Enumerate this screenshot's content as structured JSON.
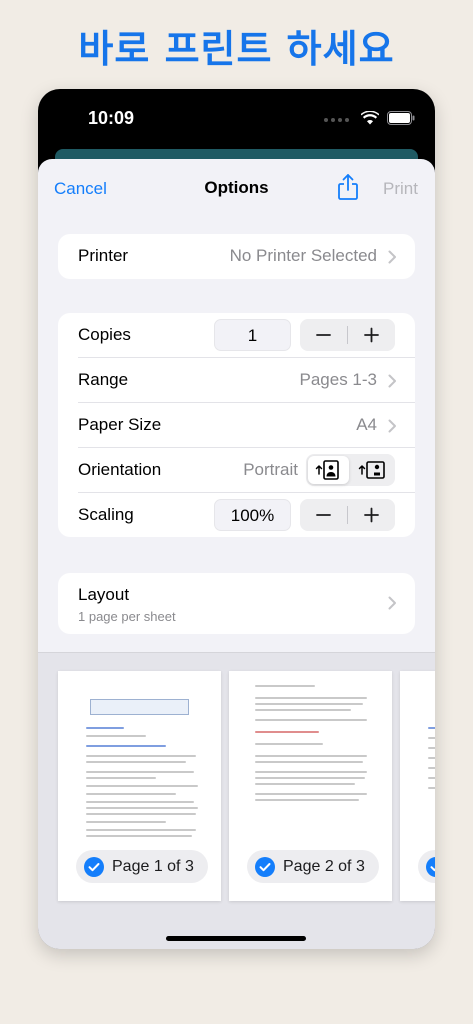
{
  "promo": {
    "headline": "바로 프린트 하세요"
  },
  "status_bar": {
    "time": "10:09"
  },
  "nav": {
    "cancel": "Cancel",
    "title": "Options",
    "print": "Print",
    "share_icon": "share-icon"
  },
  "printer": {
    "label": "Printer",
    "value": "No Printer Selected"
  },
  "options": {
    "copies": {
      "label": "Copies",
      "value": "1",
      "minus": "−",
      "plus": "+"
    },
    "range": {
      "label": "Range",
      "value": "Pages 1-3"
    },
    "paper_size": {
      "label": "Paper Size",
      "value": "A4"
    },
    "orientation": {
      "label": "Orientation",
      "value": "Portrait"
    },
    "scaling": {
      "label": "Scaling",
      "value": "100%",
      "minus": "−",
      "plus": "+"
    }
  },
  "layout": {
    "label": "Layout",
    "sublabel": "1 page per sheet"
  },
  "previews": {
    "page1": {
      "badge": "Page 1 of 3",
      "selected": true
    },
    "page2": {
      "badge": "Page 2 of 3",
      "selected": true
    },
    "page3": {
      "selected": true
    }
  },
  "colors": {
    "accent": "#147efb",
    "promo": "#1675ea",
    "background": "#f1ece5"
  }
}
